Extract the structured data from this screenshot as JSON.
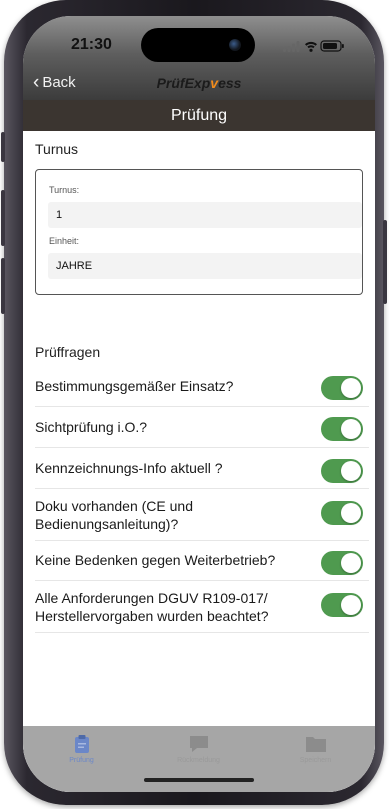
{
  "status": {
    "time": "21:30"
  },
  "nav": {
    "back_label": "Back",
    "logo_pre": "PrüfExp",
    "logo_accent": "v",
    "logo_post": "ess"
  },
  "header": {
    "title": "Prüfung"
  },
  "turnus": {
    "heading": "Turnus",
    "turnus_label": "Turnus:",
    "turnus_value": "1",
    "einheit_label": "Einheit:",
    "einheit_value": "JAHRE"
  },
  "pruefragen": {
    "heading": "Prüffragen",
    "items": [
      {
        "label": "Bestimmungsgemäßer Einsatz?",
        "checked": true
      },
      {
        "label": "Sichtprüfung i.O.?",
        "checked": true
      },
      {
        "label": "Kennzeichnungs-Info aktuell ?",
        "checked": true
      },
      {
        "label": "Doku vorhanden (CE und Bedienungsanleitung)?",
        "checked": true
      },
      {
        "label": "Keine Bedenken gegen Weiterbetrieb?",
        "checked": true
      },
      {
        "label": "Alle Anforderungen DGUV R109-017/ Herstellervorgaben wurden beachtet?",
        "checked": true
      }
    ]
  },
  "tabbar": {
    "tabs": [
      {
        "label": "Prüfung",
        "icon": "clipboard-icon",
        "active": true
      },
      {
        "label": "Rückmeldung",
        "icon": "chat-bubble-icon",
        "active": false
      },
      {
        "label": "Speichern",
        "icon": "folder-icon",
        "active": false
      }
    ]
  },
  "colors": {
    "toggle_on": "#4f9a4f",
    "title_bar": "#3b3530",
    "logo_accent": "#f28c1c",
    "tab_active": "#6b87c8"
  }
}
